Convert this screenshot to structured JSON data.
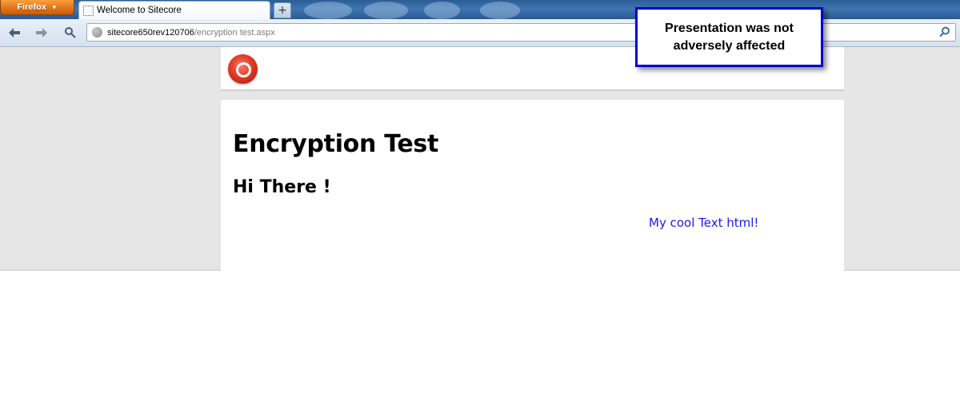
{
  "browser": {
    "menu_button_label": "Firefox",
    "tab_title": "Welcome to Sitecore",
    "new_tab_label": "+",
    "url_host": "sitecore650rev120706",
    "url_path": "/encryption test.aspx"
  },
  "page": {
    "title": "Encryption Test",
    "subtitle": "Hi There !",
    "link_text": "My cool Text html!"
  },
  "annotation": {
    "text": "Presentation was not adversely affected"
  },
  "colors": {
    "link": "#1a1aee",
    "callout_border": "#0000d4",
    "page_background": "#e6e6e6"
  }
}
